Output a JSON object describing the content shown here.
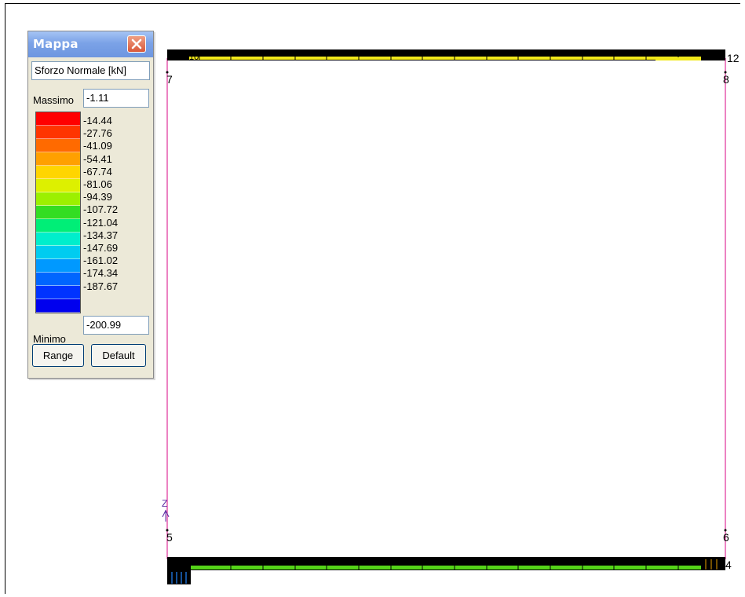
{
  "mappa": {
    "title": "Mappa",
    "quantity": "Sforzo Normale [kN]",
    "max_label": "Massimo",
    "max_value": "-1.11",
    "min_label": "Minimo",
    "min_value": "-200.99",
    "range_button": "Range",
    "default_button": "Default",
    "legend": [
      {
        "color": "#ff0000",
        "value": "-14.44"
      },
      {
        "color": "#ff3500",
        "value": "-27.76"
      },
      {
        "color": "#ff6a00",
        "value": "-41.09"
      },
      {
        "color": "#ffa000",
        "value": "-54.41"
      },
      {
        "color": "#ffd500",
        "value": "-67.74"
      },
      {
        "color": "#ddf000",
        "value": "-81.06"
      },
      {
        "color": "#9cf000",
        "value": "-94.39"
      },
      {
        "color": "#33dd22",
        "value": "-107.72"
      },
      {
        "color": "#00ee77",
        "value": "-121.04"
      },
      {
        "color": "#00eecc",
        "value": "-134.37"
      },
      {
        "color": "#00ccf0",
        "value": "-147.69"
      },
      {
        "color": "#0099ff",
        "value": "-161.02"
      },
      {
        "color": "#0066ff",
        "value": "-174.34"
      },
      {
        "color": "#0033ff",
        "value": "-187.67"
      },
      {
        "color": "#0000ee",
        "value": ""
      }
    ]
  },
  "nodes": {
    "n7": "7",
    "n8": "8",
    "n12": "12",
    "n5": "5",
    "n6": "6",
    "n4": "4",
    "n10": "10"
  },
  "axis_label": "Z",
  "colors": {
    "frame_line": "#e0309a",
    "beam_top": "#f0e81a",
    "beam_bottom": "#55d418",
    "beam_edge": "#000000",
    "support": "#1a6acb"
  }
}
